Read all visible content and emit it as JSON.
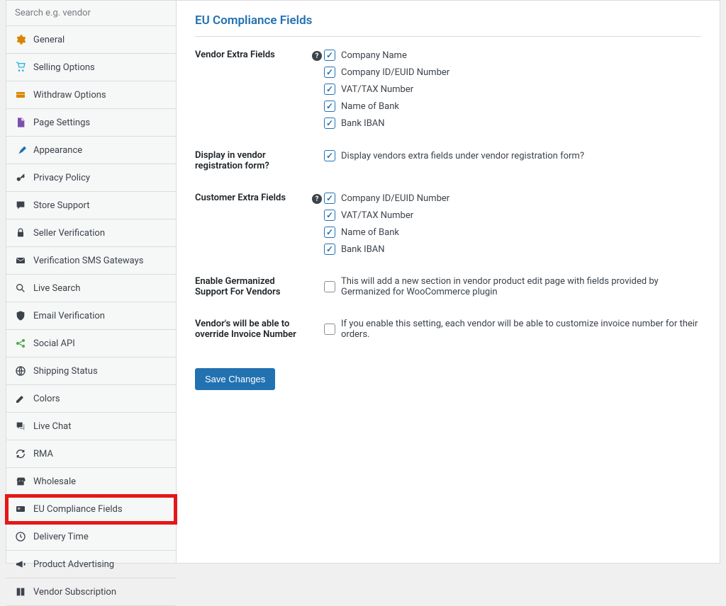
{
  "search": {
    "placeholder": "Search e.g. vendor"
  },
  "sidebar": {
    "items": [
      {
        "label": "General",
        "icon": "gear",
        "color": "#d98500"
      },
      {
        "label": "Selling Options",
        "icon": "cart",
        "color": "#28b6db"
      },
      {
        "label": "Withdraw Options",
        "icon": "withdraw",
        "color": "#d98500"
      },
      {
        "label": "Page Settings",
        "icon": "page",
        "color": "#7b51ad"
      },
      {
        "label": "Appearance",
        "icon": "brush",
        "color": "#2271b1"
      },
      {
        "label": "Privacy Policy",
        "icon": "key",
        "color": "#3c434a"
      },
      {
        "label": "Store Support",
        "icon": "chat",
        "color": "#3c434a"
      },
      {
        "label": "Seller Verification",
        "icon": "lock",
        "color": "#3c434a"
      },
      {
        "label": "Verification SMS Gateways",
        "icon": "mail",
        "color": "#3c434a"
      },
      {
        "label": "Live Search",
        "icon": "search",
        "color": "#3c434a"
      },
      {
        "label": "Email Verification",
        "icon": "shield",
        "color": "#3c434a"
      },
      {
        "label": "Social API",
        "icon": "share",
        "color": "#4aa94a"
      },
      {
        "label": "Shipping Status",
        "icon": "globe",
        "color": "#3c434a"
      },
      {
        "label": "Colors",
        "icon": "pencil",
        "color": "#3c434a"
      },
      {
        "label": "Live Chat",
        "icon": "chat2",
        "color": "#3c434a"
      },
      {
        "label": "RMA",
        "icon": "refresh",
        "color": "#3c434a"
      },
      {
        "label": "Wholesale",
        "icon": "store",
        "color": "#3c434a"
      },
      {
        "label": "EU Compliance Fields",
        "icon": "card",
        "color": "#3c434a",
        "active": true
      },
      {
        "label": "Delivery Time",
        "icon": "clock",
        "color": "#3c434a"
      },
      {
        "label": "Product Advertising",
        "icon": "megaphone",
        "color": "#3c434a"
      },
      {
        "label": "Vendor Subscription",
        "icon": "book",
        "color": "#3c434a"
      }
    ]
  },
  "main": {
    "title": "EU Compliance Fields",
    "sections": [
      {
        "label": "Vendor Extra Fields",
        "help": true,
        "options": [
          {
            "label": "Company Name",
            "checked": true
          },
          {
            "label": "Company ID/EUID Number",
            "checked": true
          },
          {
            "label": "VAT/TAX Number",
            "checked": true
          },
          {
            "label": "Name of Bank",
            "checked": true
          },
          {
            "label": "Bank IBAN",
            "checked": true
          }
        ]
      },
      {
        "label": "Display in vendor registration form?",
        "help": false,
        "options": [
          {
            "label": "Display vendors extra fields under vendor registration form?",
            "checked": true
          }
        ]
      },
      {
        "label": "Customer Extra Fields",
        "help": true,
        "options": [
          {
            "label": "Company ID/EUID Number",
            "checked": true
          },
          {
            "label": "VAT/TAX Number",
            "checked": true
          },
          {
            "label": "Name of Bank",
            "checked": true
          },
          {
            "label": "Bank IBAN",
            "checked": true
          }
        ]
      },
      {
        "label": "Enable Germanized Support For Vendors",
        "help": false,
        "options": [
          {
            "label": "This will add a new section in vendor product edit page with fields provided by Germanized for WooCommerce plugin",
            "checked": false
          }
        ]
      },
      {
        "label": "Vendor's will be able to override Invoice Number",
        "help": false,
        "options": [
          {
            "label": "If you enable this setting, each vendor will be able to customize invoice number for their orders.",
            "checked": false
          }
        ]
      }
    ],
    "save_label": "Save Changes"
  }
}
